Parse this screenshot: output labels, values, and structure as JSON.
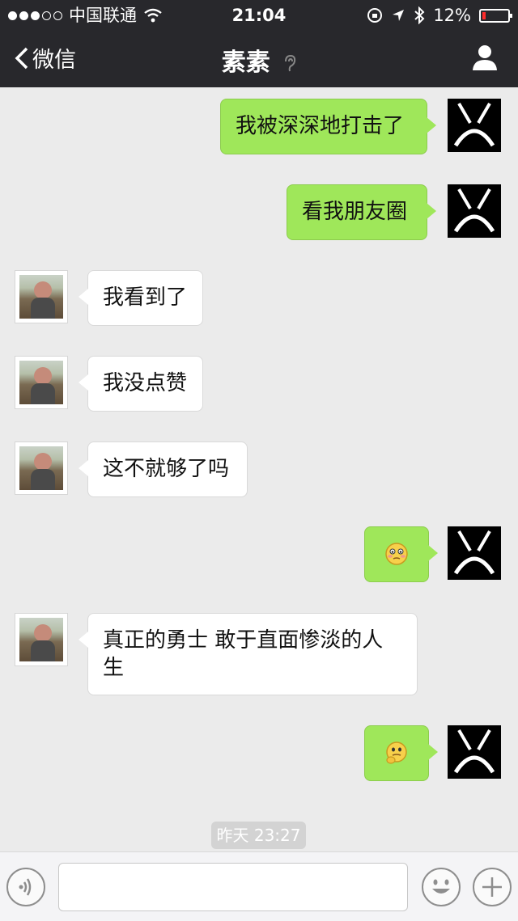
{
  "status": {
    "carrier": "中国联通",
    "time": "21:04",
    "battery": "12%",
    "signal_dots_filled": 3,
    "signal_dots_total": 5
  },
  "nav": {
    "back_label": "微信",
    "title": "素素",
    "title_icon": "ear-icon",
    "right_icon": "person-icon"
  },
  "messages": [
    {
      "from": "me",
      "text": "我被深深地打击了"
    },
    {
      "from": "me",
      "text": "看我朋友圈"
    },
    {
      "from": "them",
      "text": "我看到了"
    },
    {
      "from": "them",
      "text": "我没点赞"
    },
    {
      "from": "them",
      "text": "这不就够了吗"
    },
    {
      "from": "me",
      "emoji": "shy-face-icon"
    },
    {
      "from": "them",
      "text": "真正的勇士 敢于直面惨淡的人生"
    },
    {
      "from": "me",
      "emoji": "thinking-face-icon"
    }
  ],
  "timestamp": "昨天 23:27",
  "input": {
    "left_icon": "voice-icon",
    "emoji_icon": "smiley-icon",
    "plus_icon": "plus-icon",
    "placeholder": ""
  },
  "colors": {
    "nav_bg": "#28282c",
    "chat_bg": "#ebebeb",
    "my_bubble": "#9fe75a",
    "their_bubble": "#ffffff",
    "battery_low": "#ff2b2b"
  }
}
